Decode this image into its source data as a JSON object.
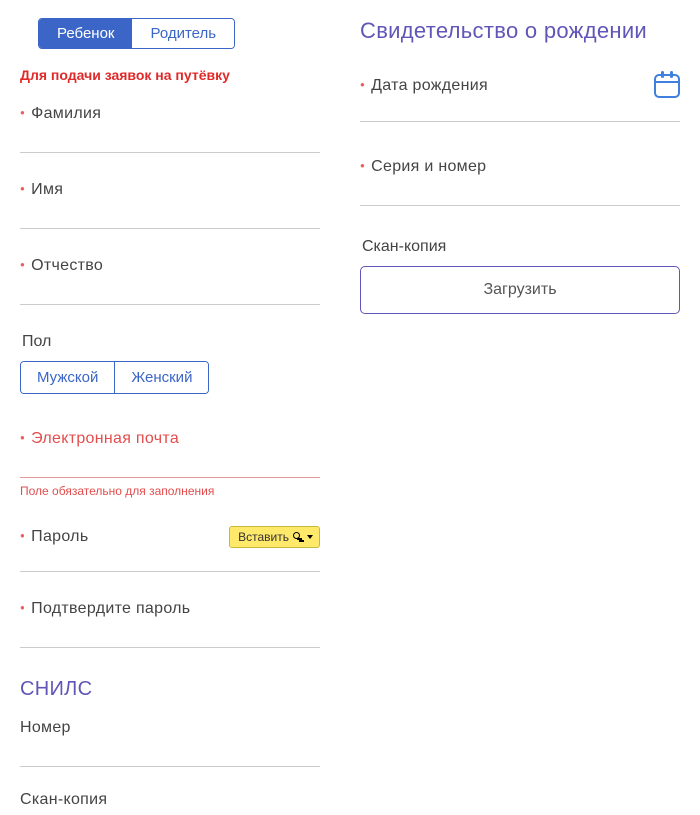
{
  "tabs": {
    "child": "Ребенок",
    "parent": "Родитель"
  },
  "notice": "Для подачи заявок на путёвку",
  "left": {
    "surname": "Фамилия",
    "name": "Имя",
    "patronymic": "Отчество",
    "gender_label": "Пол",
    "gender_male": "Мужской",
    "gender_female": "Женский",
    "email": "Электронная почта",
    "email_err": "Поле обязательно для заполнения",
    "password": "Пароль",
    "paste": "Вставить",
    "password_confirm": "Подтвердите пароль",
    "snils_title": "СНИЛС",
    "snils_number": "Номер",
    "snils_scan": "Скан-копия"
  },
  "right": {
    "title": "Свидетельство о рождении",
    "birthdate": "Дата рождения",
    "series_number": "Серия и номер",
    "scan_label": "Скан-копия",
    "upload": "Загрузить"
  }
}
